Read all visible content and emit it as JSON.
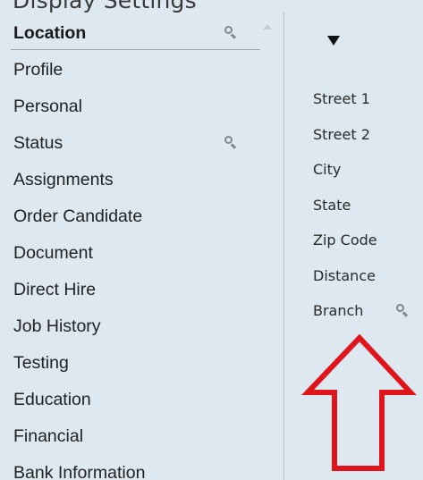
{
  "header": {
    "cropped_title": "Display Settings"
  },
  "categories": {
    "items": [
      {
        "label": "Location",
        "active": true,
        "has_search": true
      },
      {
        "label": "Profile"
      },
      {
        "label": "Personal"
      },
      {
        "label": "Status",
        "has_search": true
      },
      {
        "label": "Assignments"
      },
      {
        "label": "Order Candidate"
      },
      {
        "label": "Document"
      },
      {
        "label": "Direct Hire"
      },
      {
        "label": "Job History"
      },
      {
        "label": "Testing"
      },
      {
        "label": "Education"
      },
      {
        "label": "Financial"
      },
      {
        "label": "Bank Information"
      }
    ]
  },
  "fields": {
    "filter_icon": "filter-triangle-icon",
    "items": [
      {
        "label": "Street 1"
      },
      {
        "label": "Street 2"
      },
      {
        "label": "City"
      },
      {
        "label": "State"
      },
      {
        "label": "Zip Code"
      },
      {
        "label": "Distance"
      },
      {
        "label": "Branch",
        "has_search": true
      }
    ]
  },
  "annotation": {
    "color": "#e0151b",
    "shape": "up-arrow-outline",
    "points_to": "Branch"
  },
  "colors": {
    "background": "#dde8f1",
    "divider": "#b9c3cc",
    "icon": "#7f8790"
  }
}
